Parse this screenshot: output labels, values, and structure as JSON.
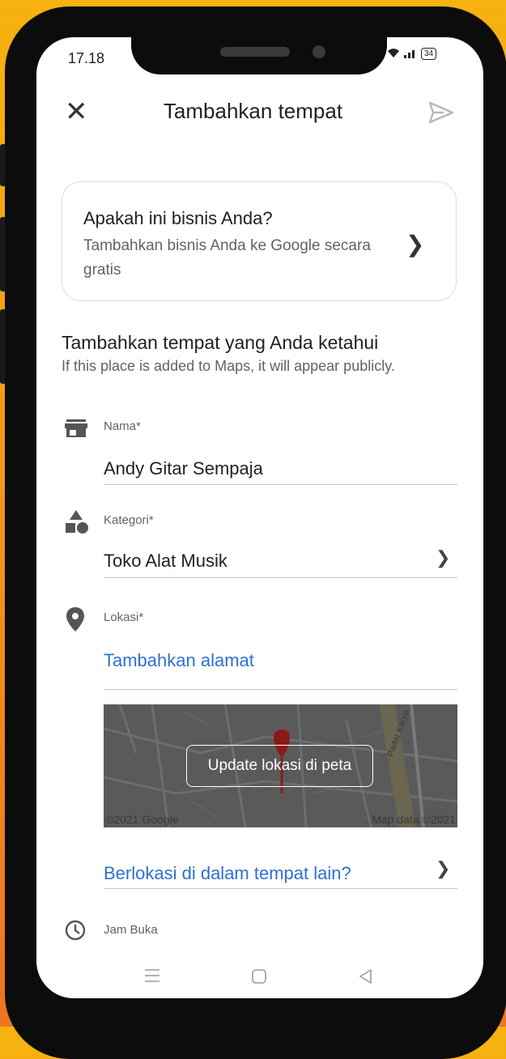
{
  "status_bar": {
    "time": "17.18",
    "battery": "34"
  },
  "top_bar": {
    "title": "Tambahkan tempat"
  },
  "business_card": {
    "title": "Apakah ini bisnis Anda?",
    "subtitle": "Tambahkan bisnis Anda ke Google secara gratis"
  },
  "section": {
    "title": "Tambahkan tempat yang Anda ketahui",
    "subtitle": "If this place is added to Maps, it will appear publicly."
  },
  "fields": {
    "name": {
      "label": "Nama*",
      "value": "Andy Gitar Sempaja"
    },
    "category": {
      "label": "Kategori*",
      "value": "Toko Alat Musik"
    },
    "location": {
      "label": "Lokasi*",
      "add_address": "Tambahkan alamat"
    },
    "hours": {
      "label": "Jam Buka"
    }
  },
  "map": {
    "update_button": "Update lokasi di peta",
    "copyright": "©2021 Google",
    "map_data": "Map data ©2021",
    "street_label": "Padat Karya"
  },
  "inside_place_link": "Berlokasi di dalam tempat lain?",
  "colors": {
    "accent": "#2f6fd2",
    "pin": "#c5221f",
    "frame_orange": "#ee7422",
    "frame_yellow": "#f7b20f"
  }
}
